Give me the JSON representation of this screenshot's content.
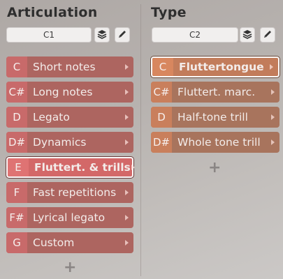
{
  "articulation": {
    "title": "Articulation",
    "preset": "C1",
    "items": [
      {
        "key": "C",
        "label": "Short notes"
      },
      {
        "key": "C#",
        "label": "Long notes"
      },
      {
        "key": "D",
        "label": "Legato"
      },
      {
        "key": "D#",
        "label": "Dynamics"
      },
      {
        "key": "E",
        "label": "Fluttert. & trills",
        "selected": true
      },
      {
        "key": "F",
        "label": "Fast repetitions"
      },
      {
        "key": "F#",
        "label": "Lyrical legato"
      },
      {
        "key": "G",
        "label": "Custom"
      }
    ],
    "add_label": "+"
  },
  "type": {
    "title": "Type",
    "preset": "C2",
    "items": [
      {
        "key": "C",
        "label": "Fluttertongue",
        "selected": true
      },
      {
        "key": "C#",
        "label": "Fluttert. marc."
      },
      {
        "key": "D",
        "label": "Half-tone trill"
      },
      {
        "key": "D#",
        "label": "Whole tone trill"
      }
    ],
    "add_label": "+"
  },
  "icons": {
    "layers": "layers-icon",
    "edit": "pencil-icon",
    "chevron": "chevron-right-icon"
  }
}
